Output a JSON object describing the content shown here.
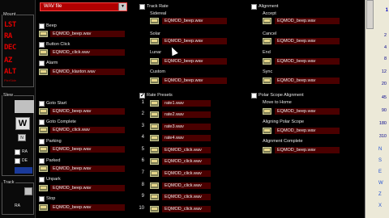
{
  "left_panel": {
    "frame1_title": "Mount",
    "readouts": [
      "LST",
      "RA",
      "DEC",
      "AZ",
      "ALT"
    ],
    "small_text": [
      "PierSide"
    ],
    "frame2_title": "Slew",
    "slew_letter": "W",
    "slew_labels": [
      "N",
      "RA",
      "DE"
    ],
    "frame3_title": "Track",
    "track_label": "RA"
  },
  "dropdown": {
    "value": "WAV file"
  },
  "col1": {
    "events": [
      {
        "label": "Beep",
        "file": "EQMOD_beep.wav"
      },
      {
        "label": "Button Click",
        "file": "EQMOD_click.wav"
      },
      {
        "label": "Alarm",
        "file": "EQMOD_klaxton.wav"
      },
      {
        "label": "Goto Start",
        "file": "EQMOD_beep.wav"
      },
      {
        "label": "Goto Complete",
        "file": "EQMOD_click.wav"
      },
      {
        "label": "Parking",
        "file": "EQMOD_beep.wav"
      },
      {
        "label": "Parked",
        "file": "EQMOD_beep.wav"
      },
      {
        "label": "Unpark",
        "file": "EQMOD_beep.wav"
      },
      {
        "label": "Stop",
        "file": "EQMOD_beep.wav"
      }
    ]
  },
  "col2": {
    "track_rate_title": "Track Rate",
    "track_rates": [
      {
        "label": "Sidereal",
        "file": "EQMOD_beep.wav"
      },
      {
        "label": "Solar",
        "file": "EQMOD_beep.wav"
      },
      {
        "label": "Lunar",
        "file": "EQMOD_beep.wav"
      },
      {
        "label": "Custom",
        "file": "EQMOD_beep.wav"
      }
    ],
    "rate_presets_title": "Rate Presets",
    "rate_presets": [
      {
        "index": "1",
        "file": "rate1.wav"
      },
      {
        "index": "2",
        "file": "rate2.wav"
      },
      {
        "index": "3",
        "file": "rate3.wav"
      },
      {
        "index": "4",
        "file": "rate4.wav"
      },
      {
        "index": "5",
        "file": "EQMOD_click.wav"
      },
      {
        "index": "6",
        "file": "EQMOD_click.wav"
      },
      {
        "index": "7",
        "file": "EQMOD_click.wav"
      },
      {
        "index": "8",
        "file": "EQMOD_click.wav"
      },
      {
        "index": "9",
        "file": "EQMOD_click.wav"
      },
      {
        "index": "10",
        "file": "EQMOD_click.wav"
      }
    ]
  },
  "col3": {
    "alignment_title": "Alignment",
    "alignment": [
      {
        "label": "Accept",
        "file": "EQMOD_beep.wav"
      },
      {
        "label": "Cancel",
        "file": "EQMOD_beep.wav"
      },
      {
        "label": "End",
        "file": "EQMOD_beep.wav"
      },
      {
        "label": "Sync",
        "file": "EQMOD_beep.wav"
      }
    ],
    "polar_title": "Polar Scope Alignment",
    "polar": [
      {
        "label": "Move to Home",
        "file": "EQMOD_beep.wav"
      },
      {
        "label": "Aligning Polar Scope",
        "file": "EQMOD_beep.wav"
      },
      {
        "label": "Alignment Complete",
        "file": "EQMOD_beep.wav"
      }
    ]
  },
  "right_panel": {
    "top_value": "1",
    "numbers": [
      "2",
      "4",
      "8",
      "12",
      "20",
      "45",
      "90",
      "180",
      "310"
    ],
    "letters": [
      "N",
      "S",
      "E",
      "W",
      "Z",
      "X"
    ]
  },
  "colors": {
    "field_bg": "#4a0000",
    "dropdown_bg": "#b00000",
    "readout_red": "#e00000"
  }
}
